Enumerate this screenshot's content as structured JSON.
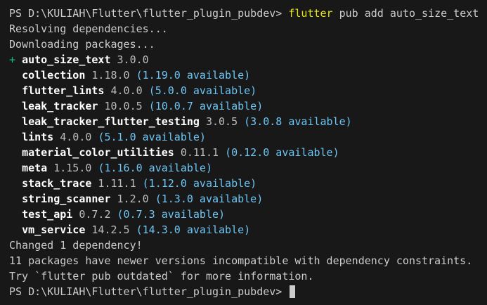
{
  "terminal": {
    "prompt1": "PS D:\\KULIAH\\Flutter\\flutter_plugin_pubdev> ",
    "command_word": "flutter",
    "command_args": " pub add auto_size_text",
    "resolving": "Resolving dependencies...",
    "downloading": "Downloading packages...",
    "added": {
      "marker": "+ ",
      "name": "auto_size_text",
      "version": " 3.0.0"
    },
    "packages": [
      {
        "name": "collection",
        "version": " 1.18.0 ",
        "available": "(1.19.0 available)"
      },
      {
        "name": "flutter_lints",
        "version": " 4.0.0 ",
        "available": "(5.0.0 available)"
      },
      {
        "name": "leak_tracker",
        "version": " 10.0.5 ",
        "available": "(10.0.7 available)"
      },
      {
        "name": "leak_tracker_flutter_testing",
        "version": " 3.0.5 ",
        "available": "(3.0.8 available)"
      },
      {
        "name": "lints",
        "version": " 4.0.0 ",
        "available": "(5.1.0 available)"
      },
      {
        "name": "material_color_utilities",
        "version": " 0.11.1 ",
        "available": "(0.12.0 available)"
      },
      {
        "name": "meta",
        "version": " 1.15.0 ",
        "available": "(1.16.0 available)"
      },
      {
        "name": "stack_trace",
        "version": " 1.11.1 ",
        "available": "(1.12.0 available)"
      },
      {
        "name": "string_scanner",
        "version": " 1.2.0 ",
        "available": "(1.3.0 available)"
      },
      {
        "name": "test_api",
        "version": " 0.7.2 ",
        "available": "(0.7.3 available)"
      },
      {
        "name": "vm_service",
        "version": " 14.2.5 ",
        "available": "(14.3.0 available)"
      }
    ],
    "changed": "Changed 1 dependency!",
    "incompatible": "11 packages have newer versions incompatible with dependency constraints.",
    "try_outdated": "Try `flutter pub outdated` for more information.",
    "prompt2": "PS D:\\KULIAH\\Flutter\\flutter_plugin_pubdev> "
  },
  "colors": {
    "background": "#181818",
    "text": "#cccccc",
    "command": "#e5e510",
    "available": "#6ec6f5",
    "plus": "#0dbc79"
  }
}
